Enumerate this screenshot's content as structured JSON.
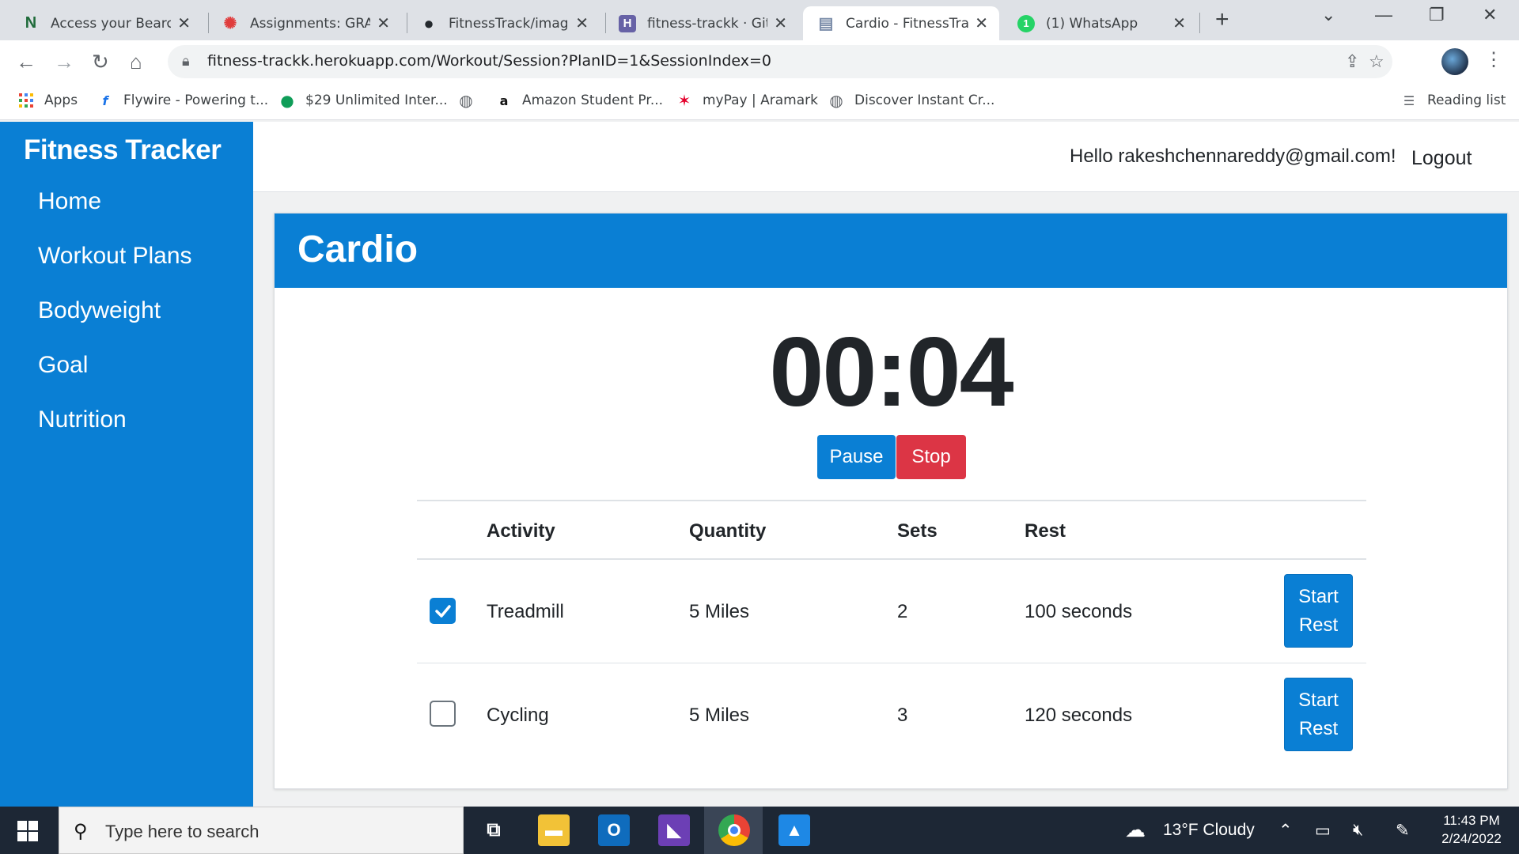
{
  "browser": {
    "tabs": [
      {
        "title": "Access your Bearca",
        "favicon": "N",
        "fav_color": "#1f6b3a",
        "active": false
      },
      {
        "title": "Assignments: GRAD",
        "favicon": "✺",
        "fav_color": "#e03c3c",
        "active": false
      },
      {
        "title": "FitnessTrack/image",
        "favicon": "●",
        "fav_color": "#24292e",
        "active": false
      },
      {
        "title": "fitness-trackk · GitH",
        "favicon": "H",
        "fav_color": "#6762a6",
        "active": false
      },
      {
        "title": "Cardio - FitnessTrac",
        "favicon": "▤",
        "fav_color": "#7a8ca8",
        "active": true
      },
      {
        "title": "(1) WhatsApp",
        "favicon": "1",
        "fav_color": "#25d366",
        "active": false
      }
    ],
    "url": "fitness-trackk.herokuapp.com/Workout/Session?PlanID=1&SessionIndex=0",
    "bookmarks": [
      {
        "label": "Apps",
        "icon": "apps-grid-icon"
      },
      {
        "label": "Flywire - Powering t...",
        "icon": "flywire-icon"
      },
      {
        "label": "$29 Unlimited Inter...",
        "icon": "green-leaf-icon"
      },
      {
        "label": "",
        "icon": "globe-icon"
      },
      {
        "label": "Amazon Student Pr...",
        "icon": "amazon-icon"
      },
      {
        "label": "myPay | Aramark",
        "icon": "aramark-icon"
      },
      {
        "label": "Discover Instant Cr...",
        "icon": "globe-icon"
      }
    ],
    "reading_list": "Reading list"
  },
  "app": {
    "brand": "Fitness Tracker",
    "nav": [
      "Home",
      "Workout Plans",
      "Bodyweight",
      "Goal",
      "Nutrition"
    ],
    "greeting": "Hello rakeshchennareddy@gmail.com!",
    "logout": "Logout",
    "session": {
      "title": "Cardio",
      "timer": "00:04",
      "pause_label": "Pause",
      "stop_label": "Stop",
      "columns": [
        "Activity",
        "Quantity",
        "Sets",
        "Rest"
      ],
      "rows": [
        {
          "done": true,
          "activity": "Treadmill",
          "quantity": "5 Miles",
          "sets": "2",
          "rest": "100 seconds",
          "action_line1": "Start",
          "action_line2": "Rest"
        },
        {
          "done": false,
          "activity": "Cycling",
          "quantity": "5 Miles",
          "sets": "3",
          "rest": "120 seconds",
          "action_line1": "Start",
          "action_line2": "Rest"
        }
      ]
    },
    "colors": {
      "primary": "#0a7fd4",
      "danger": "#dc3545"
    }
  },
  "taskbar": {
    "search_placeholder": "Type here to search",
    "weather": "13°F  Cloudy",
    "time": "11:43 PM",
    "date": "2/24/2022"
  }
}
